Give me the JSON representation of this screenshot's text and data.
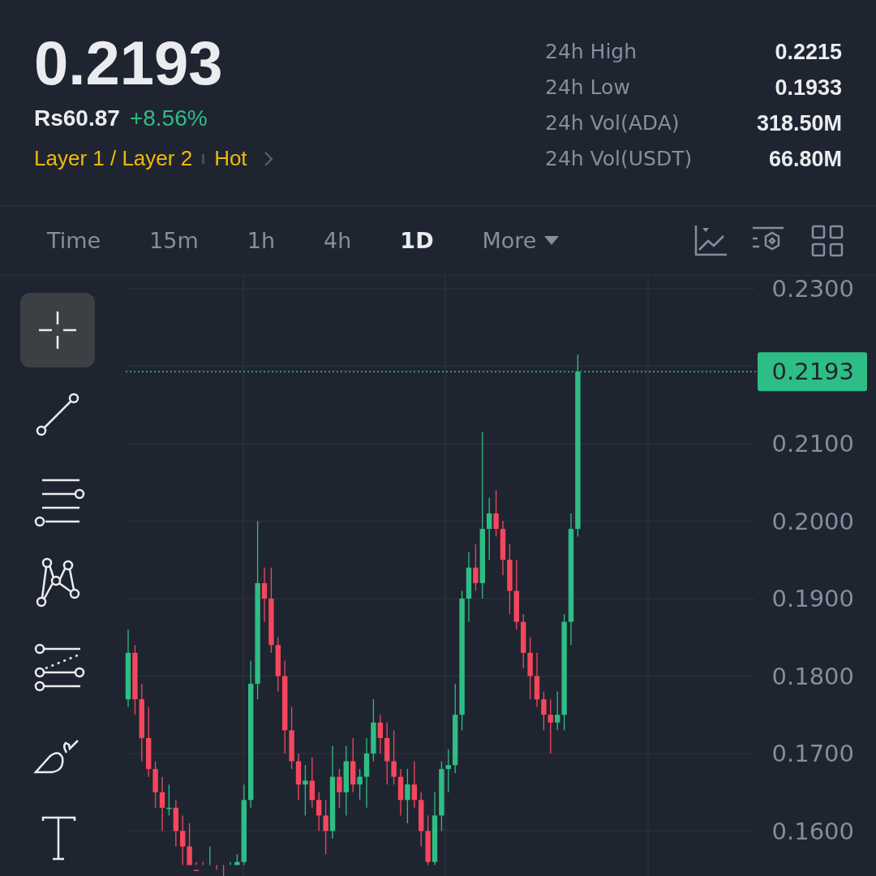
{
  "ticker": {
    "price": "0.2193",
    "fiat_price": "Rs60.87",
    "change": "+8.56%",
    "tags": [
      "Layer 1 / Layer 2",
      "Hot"
    ]
  },
  "stats": [
    {
      "label": "24h High",
      "value": "0.2215"
    },
    {
      "label": "24h Low",
      "value": "0.1933"
    },
    {
      "label": "24h Vol(ADA)",
      "value": "318.50M"
    },
    {
      "label": "24h Vol(USDT)",
      "value": "66.80M"
    }
  ],
  "intervals": [
    {
      "label": "Time",
      "selected": false
    },
    {
      "label": "15m",
      "selected": false
    },
    {
      "label": "1h",
      "selected": false
    },
    {
      "label": "4h",
      "selected": false
    },
    {
      "label": "1D",
      "selected": true
    },
    {
      "label": "More",
      "selected": false,
      "kind": "dropdown"
    }
  ],
  "drawing_tools": [
    {
      "kind": "crosshair",
      "selected": true
    },
    {
      "kind": "trend-line",
      "selected": false
    },
    {
      "kind": "parallel-lines",
      "selected": false
    },
    {
      "kind": "pattern",
      "selected": false
    },
    {
      "kind": "fib",
      "selected": false
    },
    {
      "kind": "brush",
      "selected": false
    },
    {
      "kind": "text",
      "selected": false
    }
  ],
  "chart": {
    "price_labels": [
      "0.2300",
      "0.2100",
      "0.2000",
      "0.1900",
      "0.1800",
      "0.1700",
      "0.1600"
    ],
    "current_price": "0.2193"
  }
}
